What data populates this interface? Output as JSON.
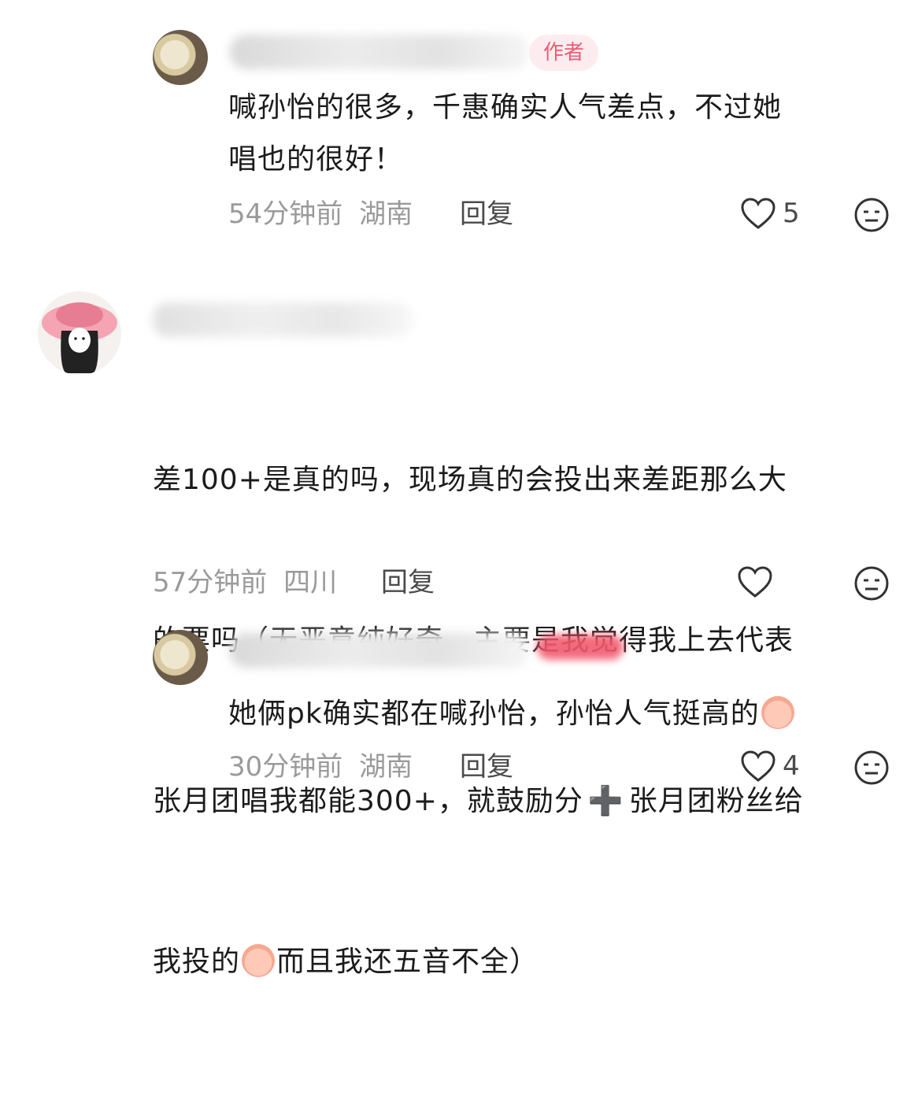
{
  "comments": [
    {
      "badge": "作者",
      "text": "喊孙怡的很多，千惠确实人气差点，不过她\n唱也的很好！",
      "time": "54分钟前",
      "location": "湖南",
      "reply_label": "回复",
      "likes": "5"
    },
    {
      "text_line1": "差100+是真的吗，现场真的会投出来差距那么大",
      "text_line2": "的票吗（无恶意纯好奇，主要是我觉得我上去代表",
      "text_line3": "张月团唱我都能300+，就鼓励分",
      "plus_icon": "➕",
      "text_line3b": "张月团粉丝给",
      "text_line4a": "我投的",
      "text_line4b": "而且我还五音不全）",
      "time": "57分钟前",
      "location": "四川",
      "reply_label": "回复",
      "likes": ""
    },
    {
      "text": "她俩pk确实都在喊孙怡，孙怡人气挺高的",
      "time": "30分钟前",
      "location": "湖南",
      "reply_label": "回复",
      "likes": "4"
    }
  ]
}
